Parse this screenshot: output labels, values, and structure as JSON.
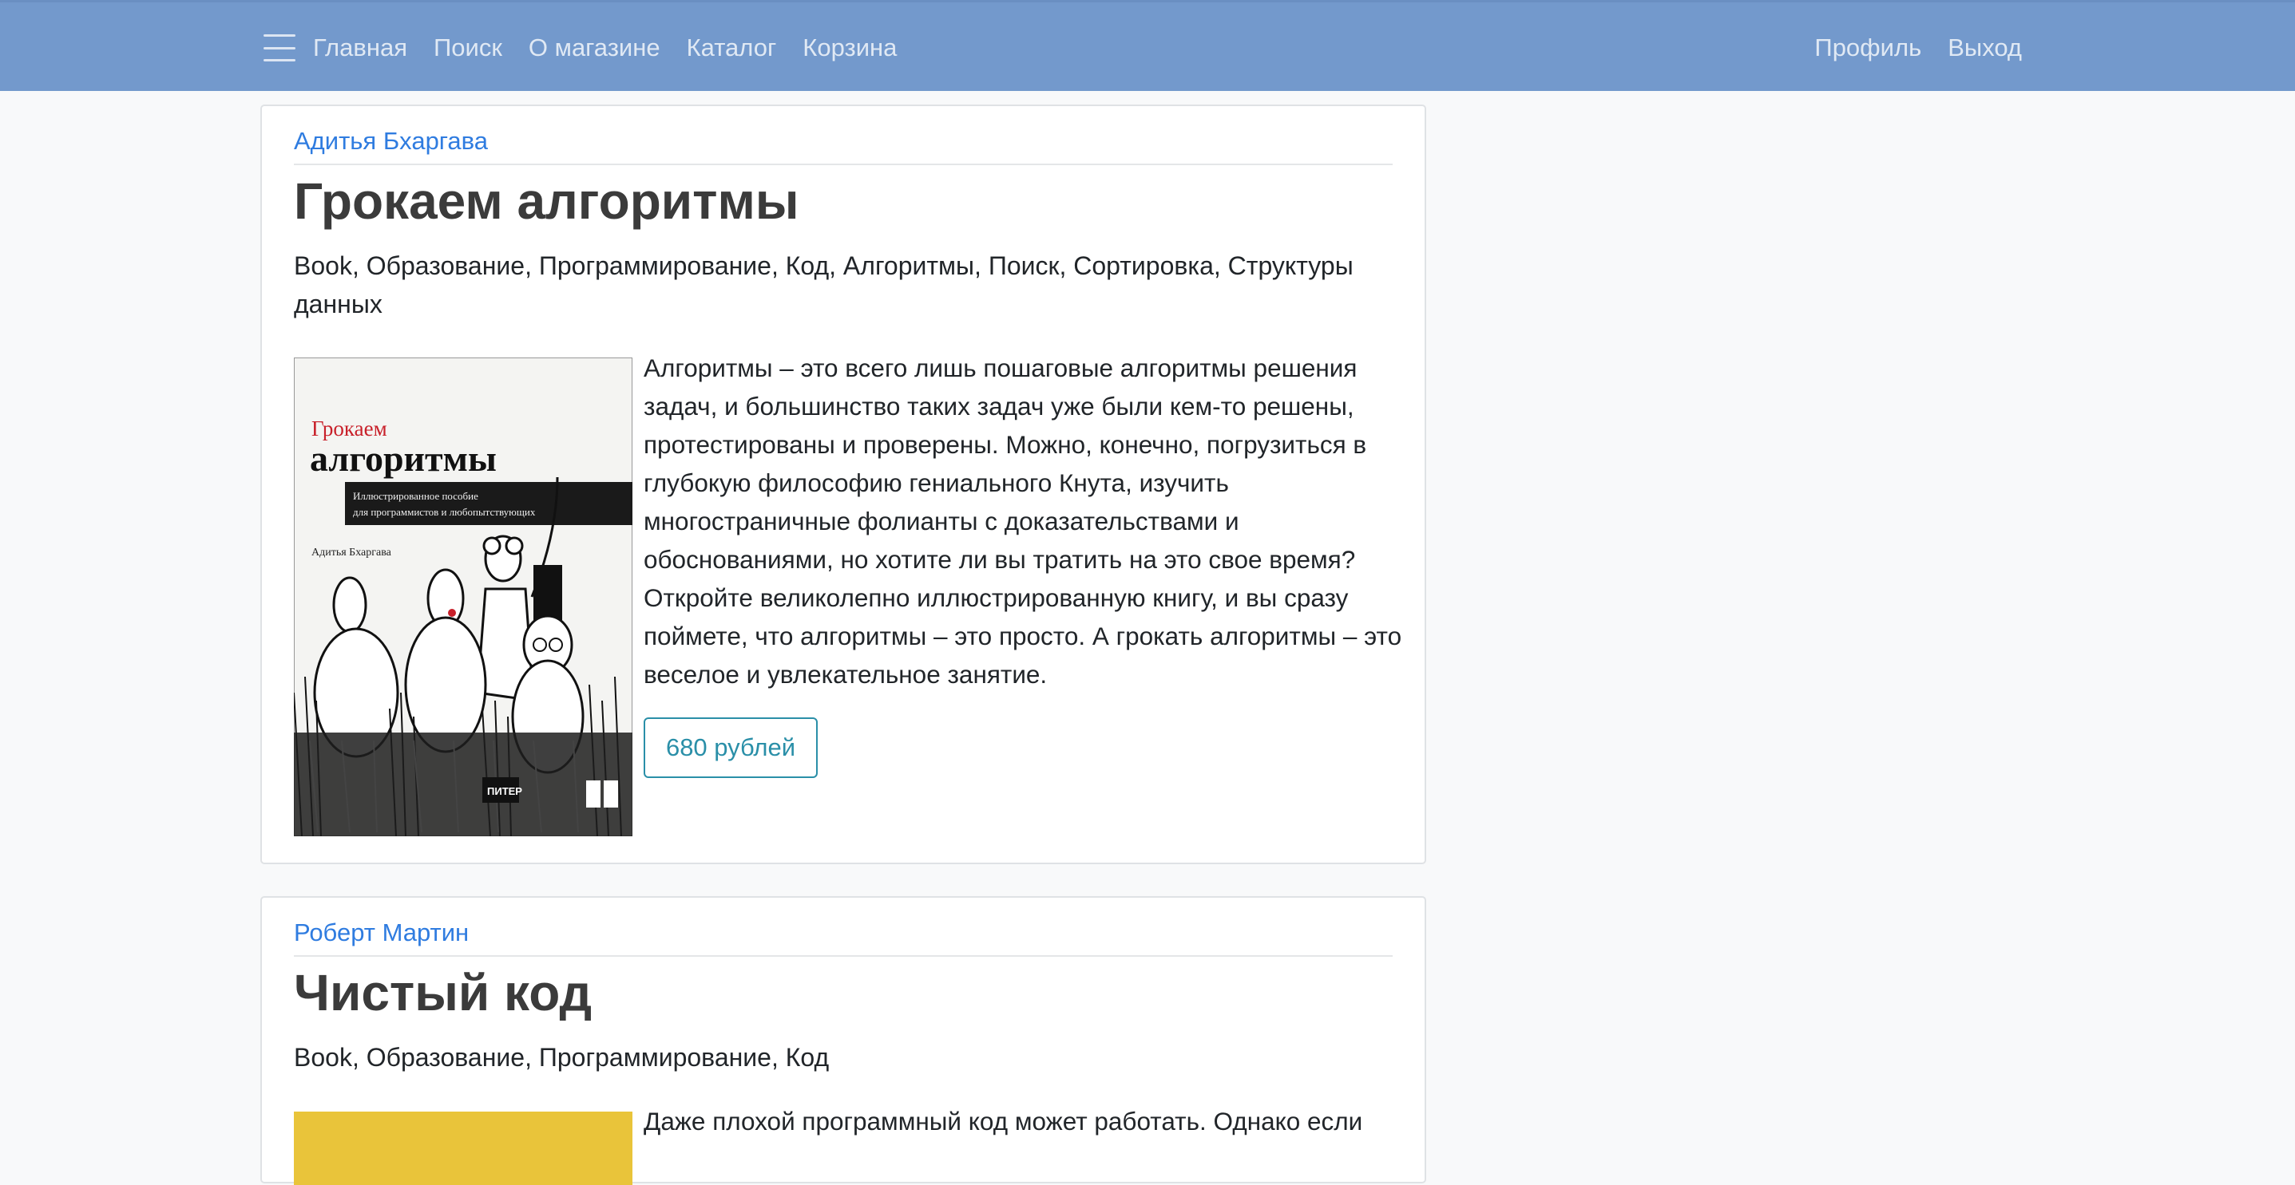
{
  "nav": {
    "left": [
      "Главная",
      "Поиск",
      "О магазине",
      "Каталог",
      "Корзина"
    ],
    "right": [
      "Профиль",
      "Выход"
    ]
  },
  "books": [
    {
      "author": "Адитья Бхаргава",
      "title": "Грокаем алгоритмы",
      "tags": "Book, Образование, Программирование, Код, Алгоритмы, Поиск, Сортировка, Структуры данных",
      "description": "Алгоритмы – это всего лишь пошаговые алгоритмы решения задач, и большинство таких задач уже были кем-то решены, протестированы и проверены. Можно, конечно, погрузиться в глубокую философию гениального Кнута, изучить многостраничные фолианты с доказательствами и обоснованиями, но хотите ли вы тратить на это свое время? Откройте великолепно иллюстрированную книгу, и вы сразу поймете, что алгоритмы – это просто. А грокать алгоритмы – это веселое и увлекательное занятие.",
      "price": "680 рублей",
      "cover": {
        "title_line1": "Грокаем",
        "title_line2": "алгоритмы",
        "subtitle_line1": "Иллюстрированное пособие",
        "subtitle_line2": "для программистов и любопытствующих",
        "author": "Адитья Бхаргава",
        "publisher": "ПИТЕР"
      }
    },
    {
      "author": "Роберт Мартин",
      "title": "Чистый код",
      "tags": "Book, Образование, Программирование, Код",
      "description": "Даже плохой программный код может работать. Однако если"
    }
  ],
  "colors": {
    "navbar": "#7399cc",
    "link": "#2f7ce0",
    "price": "#2a8fa8"
  }
}
